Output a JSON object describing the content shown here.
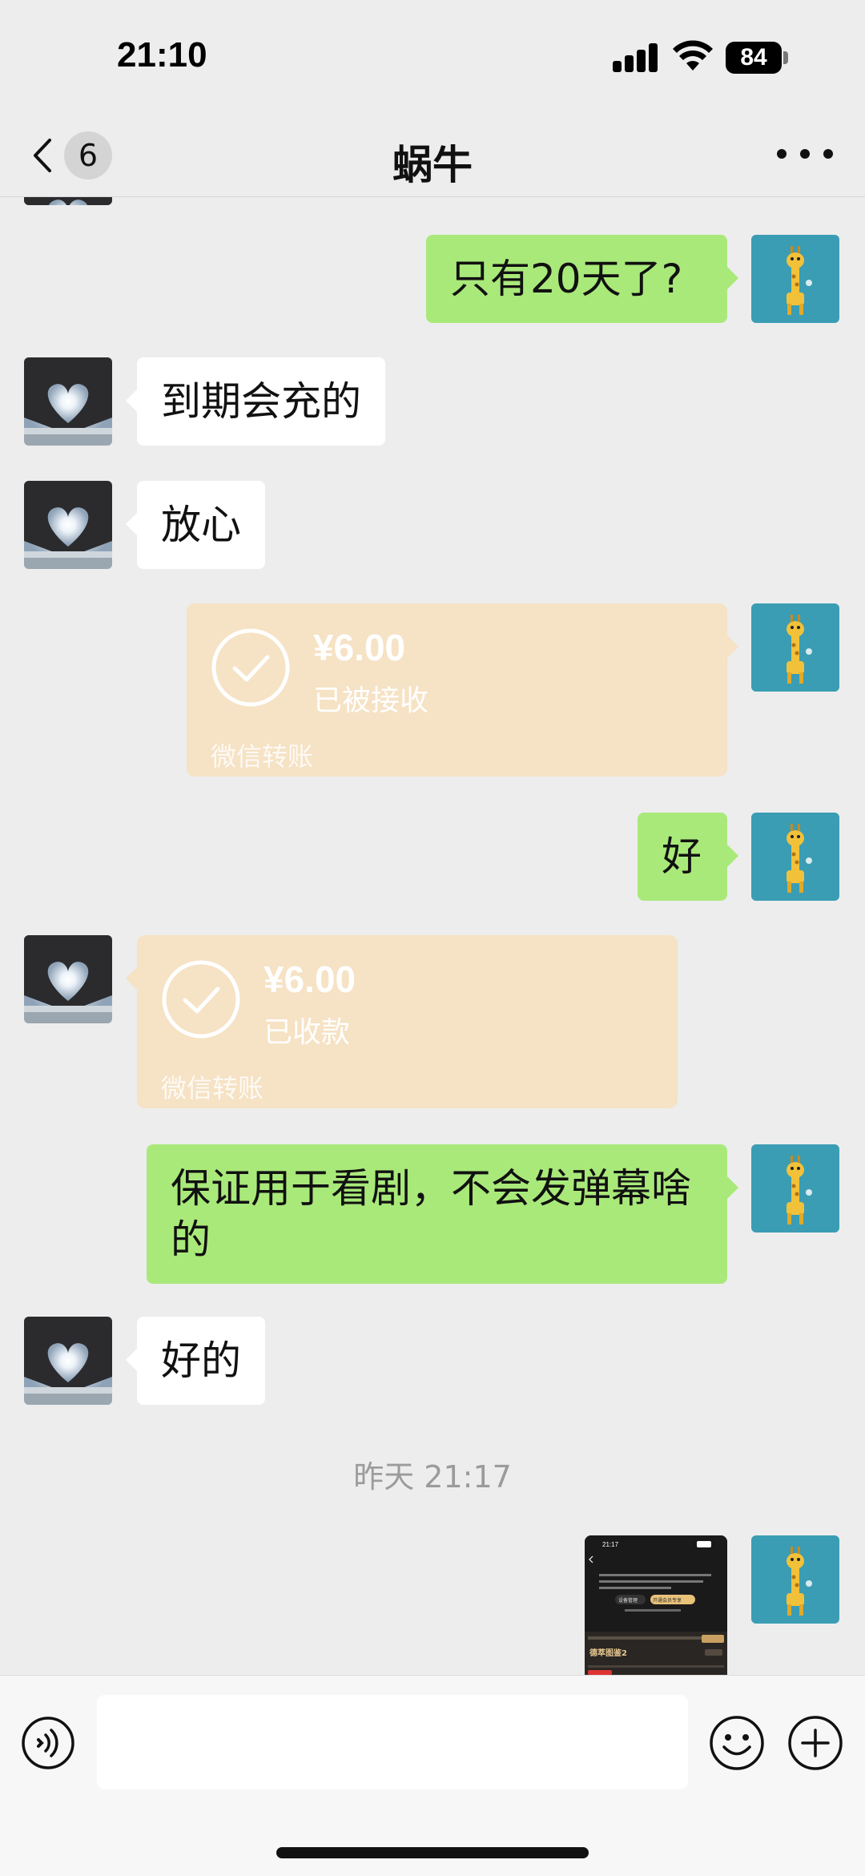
{
  "status_bar": {
    "time": "21:10",
    "battery": "84"
  },
  "nav": {
    "unread_count": "6",
    "title": "蜗牛"
  },
  "messages": [
    {
      "side": "out",
      "type": "text",
      "text": "只有20天了?"
    },
    {
      "side": "in",
      "type": "text",
      "text": "到期会充的"
    },
    {
      "side": "in",
      "type": "text",
      "text": "放心"
    },
    {
      "side": "out",
      "type": "transfer",
      "amount": "¥6.00",
      "status": "已被接收",
      "label": "微信转账"
    },
    {
      "side": "out",
      "type": "text",
      "text": "好"
    },
    {
      "side": "in",
      "type": "transfer",
      "amount": "¥6.00",
      "status": "已收款",
      "label": "微信转账"
    },
    {
      "side": "out",
      "type": "text",
      "text": "保证用于看剧，不会发弹幕啥的"
    },
    {
      "side": "in",
      "type": "text",
      "text": "好的"
    },
    {
      "type": "timestamp",
      "text": "昨天 21:17"
    },
    {
      "side": "out",
      "type": "image",
      "thumb": {
        "time": "21:17",
        "title": "德萃图鉴2",
        "btn1": "设备管理",
        "btn2": "开通会员专享"
      }
    }
  ],
  "icons": {
    "back": "chevron-left-icon",
    "more": "ellipsis-icon",
    "voice": "voice-icon",
    "emoji": "emoji-icon",
    "plus": "plus-icon"
  },
  "colors": {
    "background": "#ededed",
    "out_bubble": "#a9e97a",
    "in_bubble": "#ffffff",
    "transfer": "#f6e2c4"
  }
}
